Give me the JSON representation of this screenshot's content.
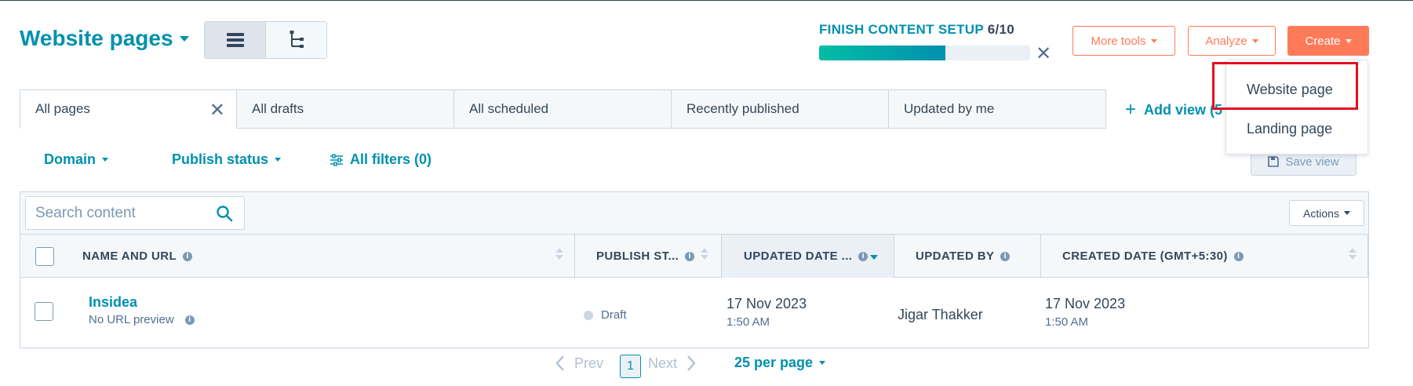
{
  "header": {
    "title": "Website pages",
    "setup_label": "FINISH CONTENT SETUP",
    "setup_count": "6/10",
    "setup_progress": 0.6,
    "more_tools_label": "More tools",
    "analyze_label": "Analyze",
    "create_label": "Create"
  },
  "create_menu": {
    "items": [
      "Website page",
      "Landing page"
    ],
    "highlighted": "Website page"
  },
  "tabs": [
    {
      "label": "All pages",
      "active": true
    },
    {
      "label": "All drafts"
    },
    {
      "label": "All scheduled"
    },
    {
      "label": "Recently published"
    },
    {
      "label": "Updated by me"
    }
  ],
  "add_view_label": "Add view (5",
  "filters": {
    "domain": "Domain",
    "publish_status": "Publish status",
    "all_filters": "All filters (0)",
    "save_view": "Save view"
  },
  "table": {
    "search_placeholder": "Search content",
    "actions_label": "Actions",
    "columns": [
      "NAME AND URL",
      "PUBLISH ST...",
      "UPDATED DATE ...",
      "UPDATED BY",
      "CREATED DATE (GMT+5:30)"
    ],
    "rows": [
      {
        "name": "Insidea",
        "url": "No URL preview",
        "status": "Draft",
        "updated_date": "17 Nov 2023",
        "updated_time": "1:50 AM",
        "updated_by": "Jigar Thakker",
        "created_date": "17 Nov 2023",
        "created_time": "1:50 AM"
      }
    ]
  },
  "pagination": {
    "prev": "Prev",
    "current": "1",
    "next": "Next",
    "per_page": "25 per page"
  },
  "colors": {
    "accent": "#0091ae",
    "orange": "#ff7a59",
    "highlight": "#e3101e"
  }
}
